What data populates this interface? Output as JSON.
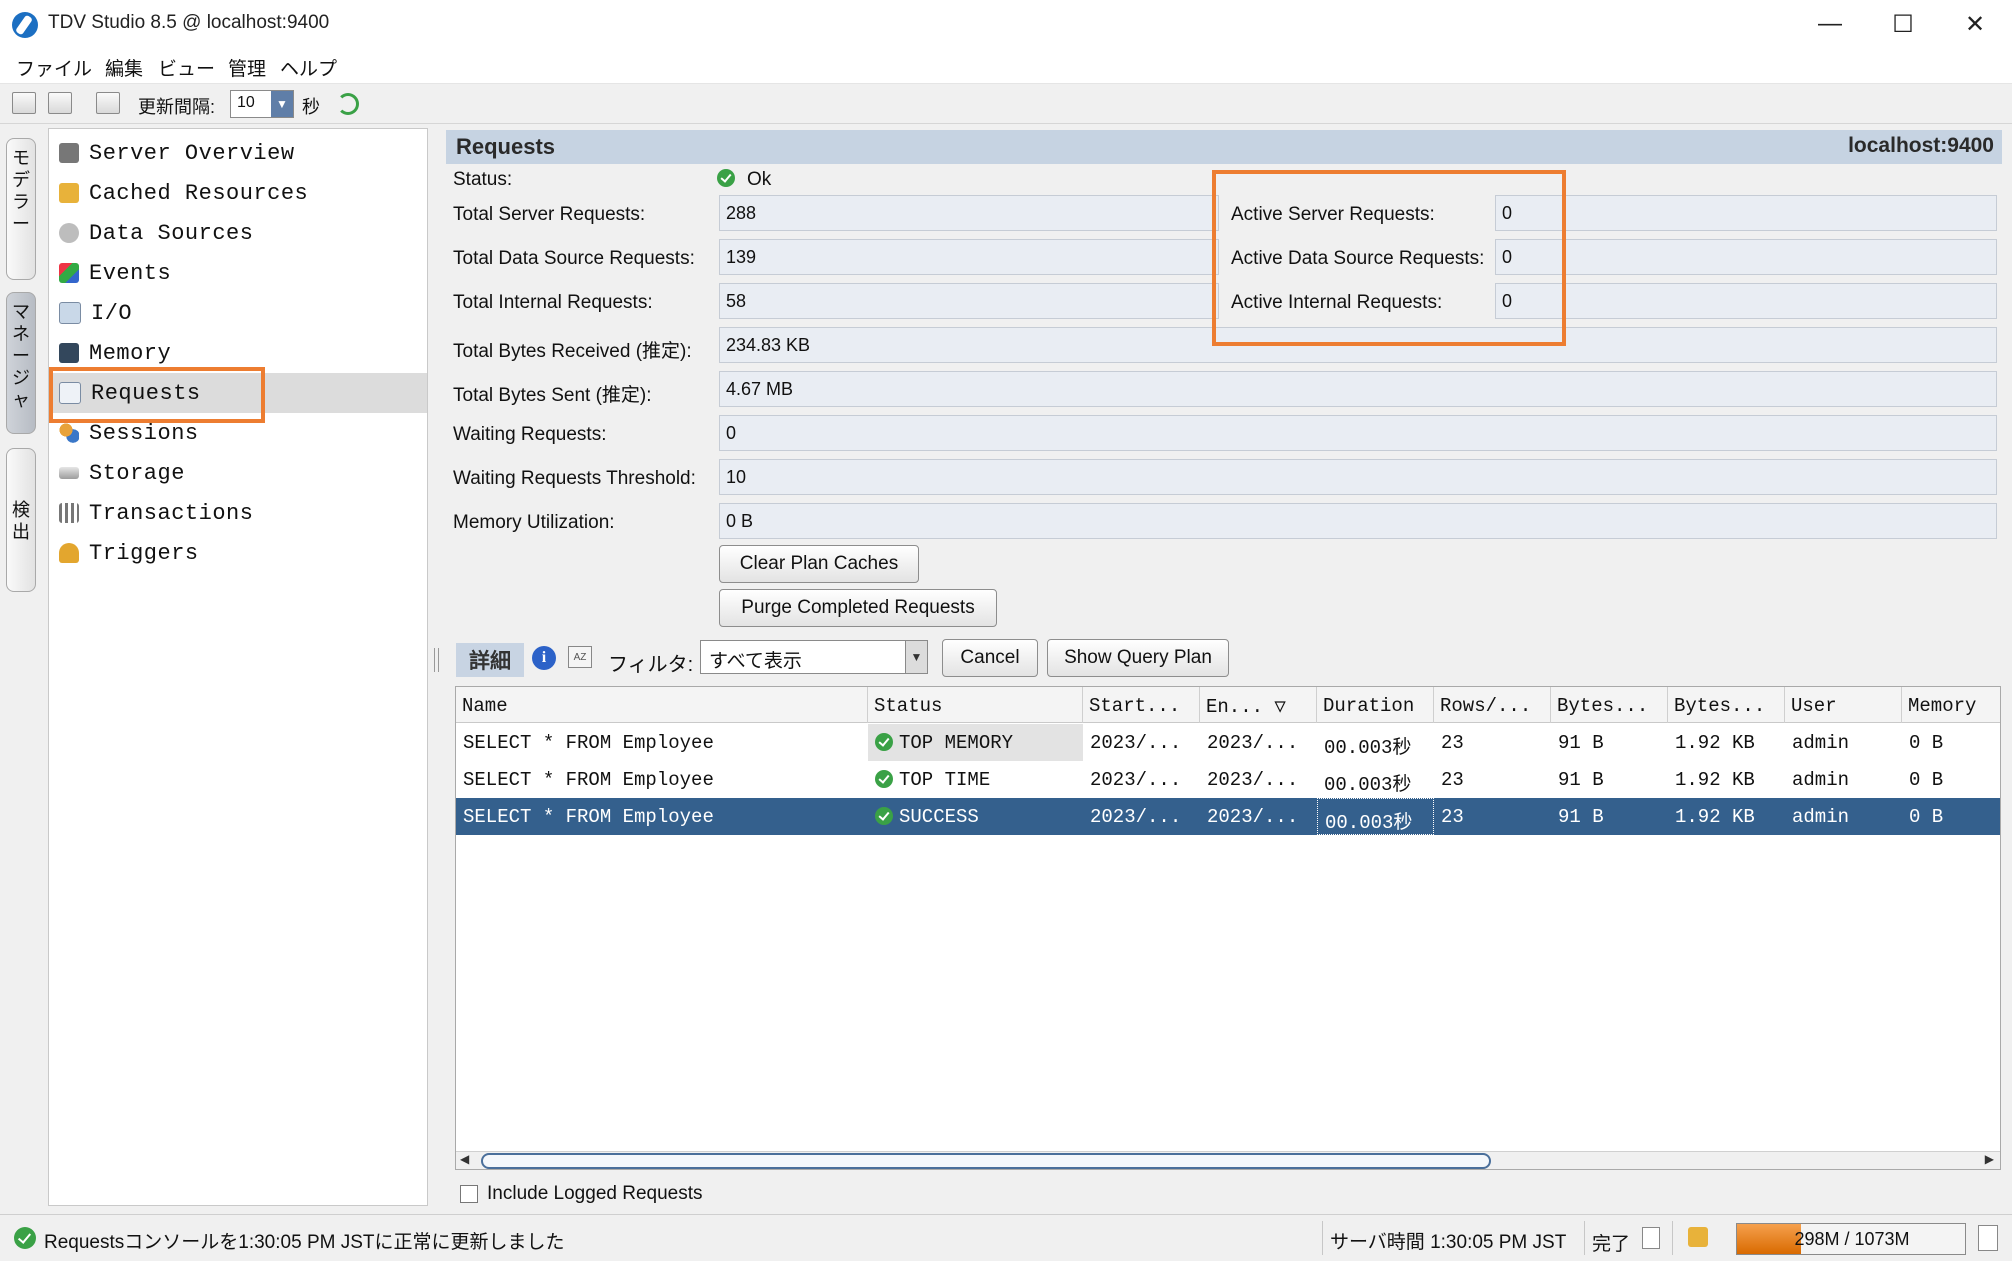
{
  "window": {
    "title": "TDV Studio 8.5 @ localhost:9400",
    "minimize": "—",
    "maximize": "☐",
    "close": "✕"
  },
  "menu": [
    "ファイル",
    "編集",
    "ビュー",
    "管理",
    "ヘルプ"
  ],
  "toolbar": {
    "refresh_label": "更新間隔:",
    "refresh_value": "10",
    "refresh_unit": "秒"
  },
  "side_tabs": [
    "モデラー",
    "マネージャ",
    "検出"
  ],
  "nav": {
    "items": [
      "Server Overview",
      "Cached Resources",
      "Data Sources",
      "Events",
      "I/O",
      "Memory",
      "Requests",
      "Sessions",
      "Storage",
      "Transactions",
      "Triggers"
    ],
    "selected": "Requests"
  },
  "panel": {
    "title": "Requests",
    "host": "localhost:9400",
    "status_label": "Status:",
    "status_value": "Ok",
    "fields": [
      {
        "label": "Total Server Requests:",
        "value": "288"
      },
      {
        "label": "Total Data Source Requests:",
        "value": "139"
      },
      {
        "label": "Total Internal Requests:",
        "value": "58"
      },
      {
        "label": "Total Bytes Received (推定):",
        "value": "234.83 KB"
      },
      {
        "label": "Total Bytes Sent (推定):",
        "value": "4.67 MB"
      },
      {
        "label": "Waiting Requests:",
        "value": "0"
      },
      {
        "label": "Waiting Requests Threshold:",
        "value": "10"
      },
      {
        "label": "Memory Utilization:",
        "value": "0 B"
      }
    ],
    "active_fields": [
      {
        "label": "Active Server Requests:",
        "value": "0"
      },
      {
        "label": "Active Data Source Requests:",
        "value": "0"
      },
      {
        "label": "Active Internal Requests:",
        "value": "0"
      }
    ],
    "clear_plan_caches": "Clear Plan Caches",
    "purge_completed": "Purge Completed Requests"
  },
  "detail": {
    "tab_label": "詳細",
    "filter_label": "フィルタ:",
    "filter_value": "すべて表示",
    "cancel": "Cancel",
    "show_query_plan": "Show Query Plan"
  },
  "table": {
    "columns": [
      "Name",
      "Status",
      "Start...",
      "En... ▽",
      "Duration",
      "Rows/...",
      "Bytes...",
      "Bytes...",
      "User",
      "Memory"
    ],
    "rows": [
      [
        "SELECT * FROM Employee",
        "TOP MEMORY",
        "2023/...",
        "2023/...",
        "00.003秒",
        "23",
        "91 B",
        "1.92 KB",
        "admin",
        "0 B"
      ],
      [
        "SELECT * FROM Employee",
        "TOP TIME",
        "2023/...",
        "2023/...",
        "00.003秒",
        "23",
        "91 B",
        "1.92 KB",
        "admin",
        "0 B"
      ],
      [
        "SELECT * FROM Employee",
        "SUCCESS",
        "2023/...",
        "2023/...",
        "00.003秒",
        "23",
        "91 B",
        "1.92 KB",
        "admin",
        "0 B"
      ]
    ],
    "selected_row": 2
  },
  "include_logged": "Include Logged Requests",
  "statusbar": {
    "message": "Requestsコンソールを1:30:05 PM JSTに正常に更新しました",
    "server_time": "サーバ時間 1:30:05 PM JST",
    "done": "完了",
    "memory": "298M / 1073M",
    "memory_used_fraction": 0.28
  },
  "colors": {
    "highlight": "#ed7d31",
    "selection": "#34608d",
    "header": "#c6d3e2",
    "ok": "#3aa146"
  }
}
